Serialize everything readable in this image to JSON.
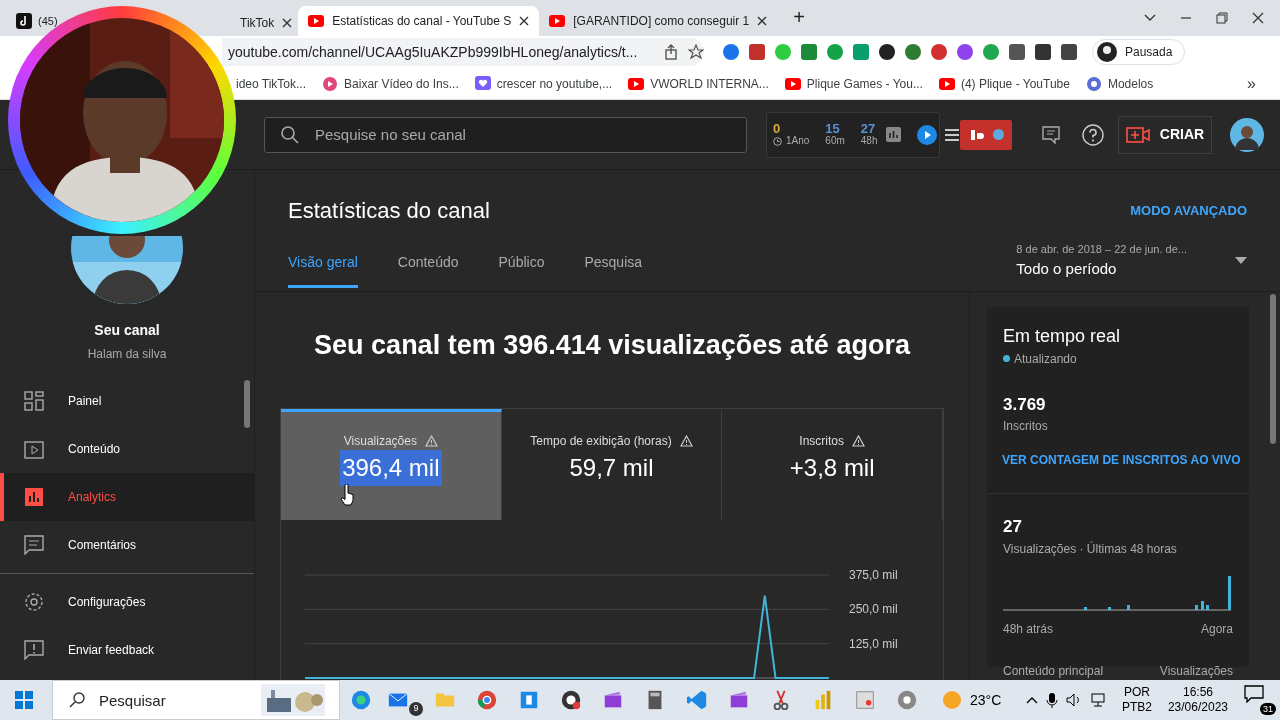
{
  "browser": {
    "tabs": [
      {
        "title_start": "(45)",
        "title_end": "TikTok",
        "selected": false
      },
      {
        "title": "Estatísticas do canal - YouTube S",
        "selected": true
      },
      {
        "title": "[GARANTIDO] como conseguir 1",
        "selected": false
      }
    ],
    "new_tab": "+",
    "address": "youtube.com/channel/UCAAg5IuAKZPb999IbHLoneg/analytics/t...",
    "profile": "Pausada",
    "bookmarks": [
      {
        "title": "ideo TikTok..."
      },
      {
        "title": "Baixar Vídeo do Ins..."
      },
      {
        "title": "crescer no youtube,..."
      },
      {
        "title": "VWORLD INTERNA..."
      },
      {
        "title": "Plique Games - You..."
      },
      {
        "title": "(4) Plique - YouTube"
      },
      {
        "title": "Modelos"
      }
    ],
    "more": "»"
  },
  "header": {
    "search_placeholder": "Pesquise no seu canal",
    "counters": [
      {
        "value": "0",
        "label": "1Ano",
        "color": "#d6a83a"
      },
      {
        "value": "15",
        "label": "60m",
        "color": "#5b8fd6"
      },
      {
        "value": "27",
        "label": "48h",
        "color": "#5b8fd6"
      }
    ],
    "create": "CRIAR"
  },
  "sidebar": {
    "channel_title": "Seu canal",
    "channel_name": "Halam da silva",
    "items": [
      {
        "label": "Painel",
        "selected": false
      },
      {
        "label": "Conteúdo",
        "selected": false
      },
      {
        "label": "Analytics",
        "selected": true
      },
      {
        "label": "Comentários",
        "selected": false
      }
    ],
    "footer_items": [
      {
        "label": "Configurações"
      },
      {
        "label": "Enviar feedback"
      }
    ]
  },
  "analytics": {
    "title": "Estatísticas do canal",
    "advanced": "MODO AVANÇADO",
    "tabs": [
      {
        "label": "Visão geral",
        "selected": true
      },
      {
        "label": "Conteúdo",
        "selected": false
      },
      {
        "label": "Público",
        "selected": false
      },
      {
        "label": "Pesquisa",
        "selected": false
      }
    ],
    "date_range": {
      "range": "8 de abr. de 2018 – 22 de jun. de...",
      "period": "Todo o período"
    },
    "headline": "Seu canal tem 396.414 visualizações até agora",
    "metrics": [
      {
        "label": "Visualizações",
        "value": "396,4 mil",
        "selected": true,
        "highlighted": true
      },
      {
        "label": "Tempo de exibição (horas)",
        "value": "59,7 mil",
        "selected": false,
        "highlighted": false
      },
      {
        "label": "Inscritos",
        "value": "+3,8 mil",
        "selected": false,
        "highlighted": false
      }
    ],
    "chart_data": {
      "type": "line",
      "ylim": [
        0,
        375
      ],
      "yticks": [
        {
          "value": 125,
          "label": "125,0 mil"
        },
        {
          "value": 250,
          "label": "250,0 mil"
        },
        {
          "value": 375,
          "label": "375,0 mil"
        }
      ],
      "series": [
        {
          "color": "#41b4d9",
          "values": [
            0,
            0,
            0,
            0,
            0,
            0,
            0,
            0,
            0,
            0,
            0,
            0,
            0,
            0,
            0,
            0,
            0,
            0,
            0,
            0,
            0,
            0,
            0,
            0,
            0,
            0,
            0,
            0,
            0,
            0,
            0,
            0,
            0,
            0,
            0,
            0,
            0,
            0,
            0,
            0,
            0,
            0,
            0,
            300,
            0,
            0,
            0,
            0,
            0,
            0
          ]
        }
      ]
    }
  },
  "realtime": {
    "title": "Em tempo real",
    "status": "Atualizando",
    "subscribers": "3.769",
    "subscribers_label": "Inscritos",
    "link": "VER CONTAGEM DE INSCRITOS AO VIVO",
    "views": "27",
    "views_label": "Visualizações · Últimas 48 horas",
    "start": "48h atrás",
    "end": "Agora",
    "column_1": "Conteúdo principal",
    "column_2": "Visualizações"
  },
  "taskbar": {
    "search_placeholder": "Pesquisar",
    "mail_badge": "9",
    "temperature": "23°C",
    "language": "POR",
    "layout": "PTB2",
    "time": "16:56",
    "date": "23/06/2023",
    "notifications": "31"
  }
}
